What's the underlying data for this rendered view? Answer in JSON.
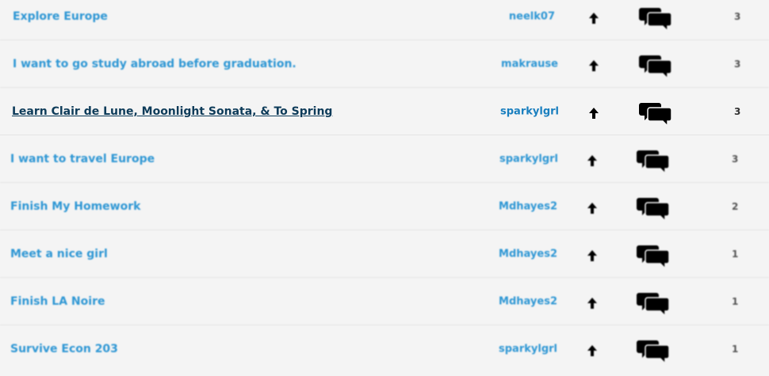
{
  "rows": [
    {
      "title": "Explore Europe",
      "user": "neelk07",
      "count": "3"
    },
    {
      "title": "I want to go study abroad before graduation.",
      "user": "makrause",
      "count": "3"
    },
    {
      "title": "Learn Clair de Lune, Moonlight Sonata, & To Spring",
      "user": "sparkylgrl",
      "count": "3"
    },
    {
      "title": "I want to travel Europe",
      "user": "sparkylgrl",
      "count": "3"
    },
    {
      "title": "Finish My Homework",
      "user": "Mdhayes2",
      "count": "2"
    },
    {
      "title": "Meet a nice girl",
      "user": "Mdhayes2",
      "count": "1"
    },
    {
      "title": "Finish LA Noire",
      "user": "Mdhayes2",
      "count": "1"
    },
    {
      "title": "Survive Econ 203",
      "user": "sparkylgrl",
      "count": "1"
    }
  ],
  "icons": {
    "vote": "up-arrow-icon",
    "comments": "speech-bubbles-icon"
  },
  "colors": {
    "link": "#2f97d4",
    "focused_link": "#0d3b59",
    "background": "#f4f4f4"
  }
}
